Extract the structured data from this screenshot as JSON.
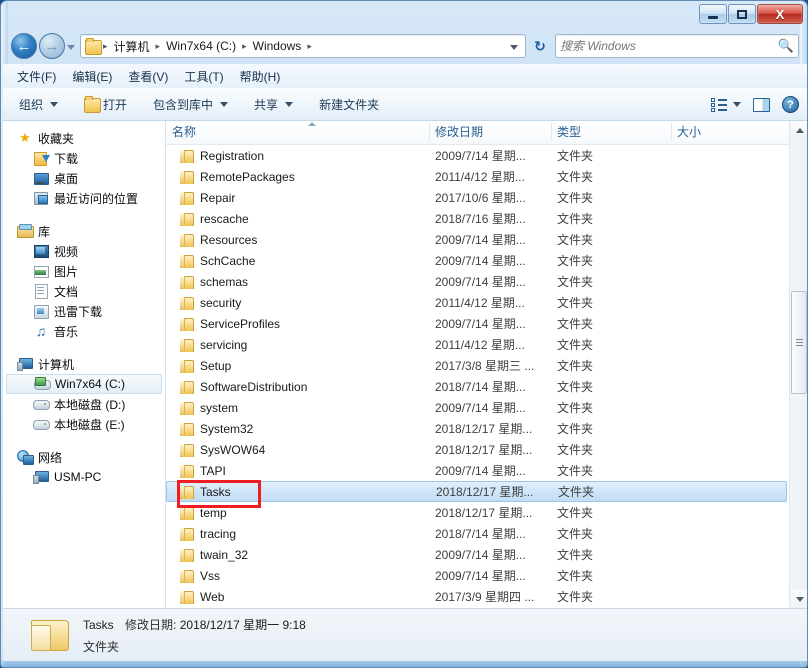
{
  "window": {
    "buttons": {
      "minimize": "—",
      "maximize": "▫",
      "close": "X"
    }
  },
  "address": {
    "back_icon": "←",
    "forward_icon": "→",
    "crumbs": [
      "计算机",
      "Win7x64 (C:)",
      "Windows"
    ],
    "separator": "▸",
    "refresh_icon": "↻"
  },
  "search": {
    "placeholder": "搜索 Windows",
    "value": "",
    "icon": "search-icon"
  },
  "menubar": {
    "items": [
      "文件(F)",
      "编辑(E)",
      "查看(V)",
      "工具(T)",
      "帮助(H)"
    ]
  },
  "toolbar": {
    "organize": "组织",
    "open": "打开",
    "include_in_library": "包含到库中",
    "share": "共享",
    "new_folder": "新建文件夹",
    "view_icon": "view-options-icon",
    "preview_icon": "preview-pane-icon",
    "help_icon": "help-icon"
  },
  "sidebar": {
    "groups": [
      {
        "header": {
          "label": "收藏夹",
          "icon": "star-icon"
        },
        "items": [
          {
            "label": "下载",
            "icon": "downloads-icon"
          },
          {
            "label": "桌面",
            "icon": "desktop-icon"
          },
          {
            "label": "最近访问的位置",
            "icon": "recent-places-icon"
          }
        ]
      },
      {
        "header": {
          "label": "库",
          "icon": "library-icon"
        },
        "items": [
          {
            "label": "视频",
            "icon": "videos-icon"
          },
          {
            "label": "图片",
            "icon": "pictures-icon"
          },
          {
            "label": "文档",
            "icon": "documents-icon"
          },
          {
            "label": "迅雷下载",
            "icon": "thunder-download-icon"
          },
          {
            "label": "音乐",
            "icon": "music-icon"
          }
        ]
      },
      {
        "header": {
          "label": "计算机",
          "icon": "computer-icon"
        },
        "items": [
          {
            "label": "Win7x64 (C:)",
            "icon": "system-drive-icon",
            "selected": true
          },
          {
            "label": "本地磁盘 (D:)",
            "icon": "drive-icon"
          },
          {
            "label": "本地磁盘 (E:)",
            "icon": "drive-icon"
          }
        ]
      },
      {
        "header": {
          "label": "网络",
          "icon": "network-icon"
        },
        "items": [
          {
            "label": "USM-PC",
            "icon": "computer-icon"
          }
        ]
      }
    ]
  },
  "filelist": {
    "columns": [
      "名称",
      "修改日期",
      "类型",
      "大小"
    ],
    "sort_column": "名称",
    "sort_direction": "asc",
    "rows": [
      {
        "name": "Registration",
        "date": "2009/7/14 星期...",
        "type": "文件夹",
        "size": ""
      },
      {
        "name": "RemotePackages",
        "date": "2011/4/12 星期...",
        "type": "文件夹",
        "size": ""
      },
      {
        "name": "Repair",
        "date": "2017/10/6 星期...",
        "type": "文件夹",
        "size": ""
      },
      {
        "name": "rescache",
        "date": "2018/7/16 星期...",
        "type": "文件夹",
        "size": ""
      },
      {
        "name": "Resources",
        "date": "2009/7/14 星期...",
        "type": "文件夹",
        "size": ""
      },
      {
        "name": "SchCache",
        "date": "2009/7/14 星期...",
        "type": "文件夹",
        "size": ""
      },
      {
        "name": "schemas",
        "date": "2009/7/14 星期...",
        "type": "文件夹",
        "size": ""
      },
      {
        "name": "security",
        "date": "2011/4/12 星期...",
        "type": "文件夹",
        "size": ""
      },
      {
        "name": "ServiceProfiles",
        "date": "2009/7/14 星期...",
        "type": "文件夹",
        "size": ""
      },
      {
        "name": "servicing",
        "date": "2011/4/12 星期...",
        "type": "文件夹",
        "size": ""
      },
      {
        "name": "Setup",
        "date": "2017/3/8 星期三 ...",
        "type": "文件夹",
        "size": ""
      },
      {
        "name": "SoftwareDistribution",
        "date": "2018/7/14 星期...",
        "type": "文件夹",
        "size": ""
      },
      {
        "name": "system",
        "date": "2009/7/14 星期...",
        "type": "文件夹",
        "size": ""
      },
      {
        "name": "System32",
        "date": "2018/12/17 星期...",
        "type": "文件夹",
        "size": ""
      },
      {
        "name": "SysWOW64",
        "date": "2018/12/17 星期...",
        "type": "文件夹",
        "size": ""
      },
      {
        "name": "TAPI",
        "date": "2009/7/14 星期...",
        "type": "文件夹",
        "size": ""
      },
      {
        "name": "Tasks",
        "date": "2018/12/17 星期...",
        "type": "文件夹",
        "size": "",
        "selected": true,
        "annotated": true
      },
      {
        "name": "temp",
        "date": "2018/12/17 星期...",
        "type": "文件夹",
        "size": ""
      },
      {
        "name": "tracing",
        "date": "2018/7/14 星期...",
        "type": "文件夹",
        "size": ""
      },
      {
        "name": "twain_32",
        "date": "2009/7/14 星期...",
        "type": "文件夹",
        "size": ""
      },
      {
        "name": "Vss",
        "date": "2009/7/14 星期...",
        "type": "文件夹",
        "size": ""
      },
      {
        "name": "Web",
        "date": "2017/3/9 星期四 ...",
        "type": "文件夹",
        "size": ""
      }
    ]
  },
  "details": {
    "name": "Tasks",
    "modified_label": "修改日期:",
    "modified_value": "2018/12/17 星期一 9:18",
    "type": "文件夹"
  },
  "colors": {
    "annotation": "#ee1c23",
    "selection": "#cfe5f8",
    "column_header_text": "#2b5f92"
  }
}
